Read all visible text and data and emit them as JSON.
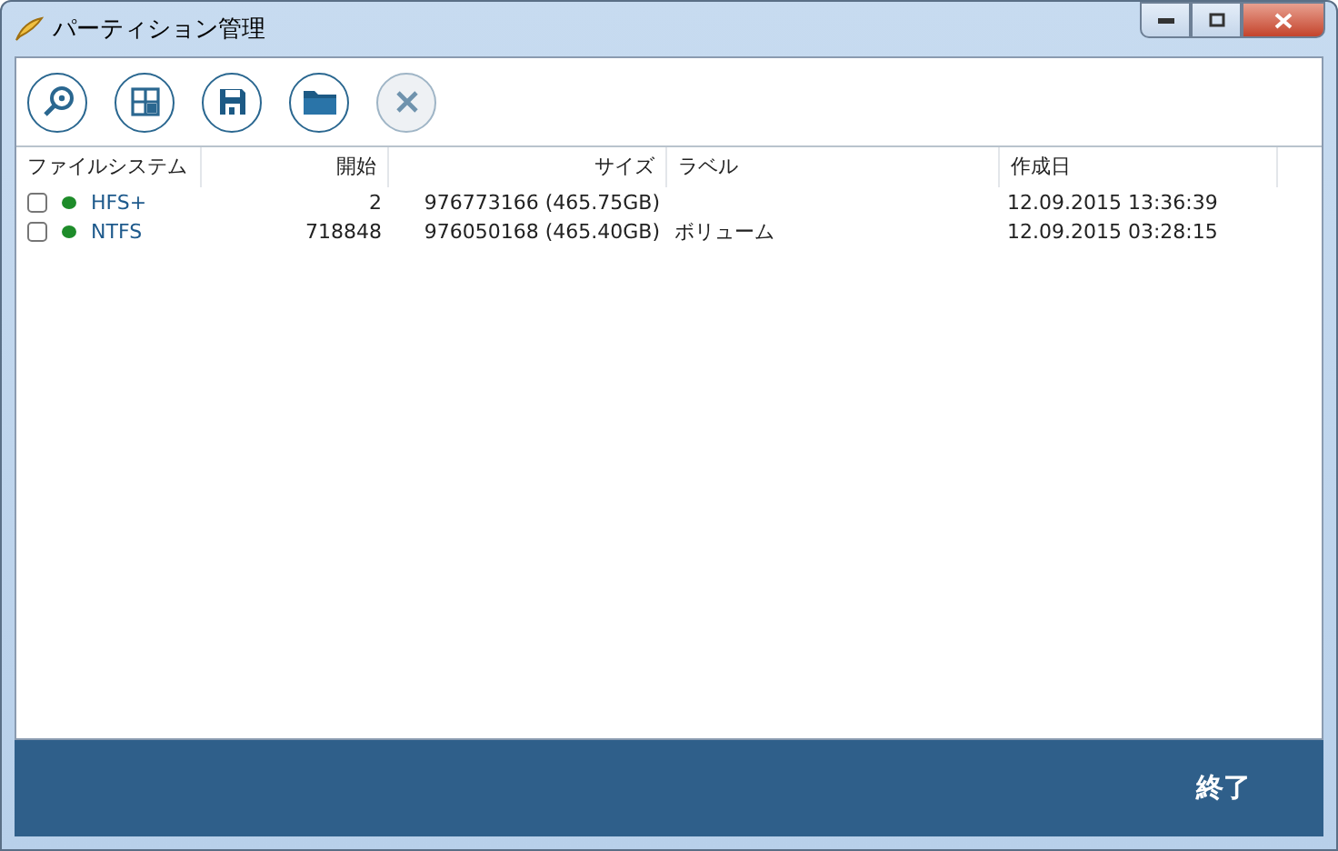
{
  "window": {
    "title": "パーティション管理"
  },
  "toolbar": [
    {
      "kind": "search",
      "disabled": false
    },
    {
      "kind": "grid",
      "disabled": false
    },
    {
      "kind": "save",
      "disabled": false
    },
    {
      "kind": "folder",
      "disabled": false
    },
    {
      "kind": "close",
      "disabled": true
    }
  ],
  "table": {
    "columns": [
      {
        "label": "ファイルシステム"
      },
      {
        "label": "開始"
      },
      {
        "label": "サイズ"
      },
      {
        "label": "ラベル"
      },
      {
        "label": "作成日"
      }
    ],
    "rows": [
      {
        "checked": false,
        "color": "#1e8c2a",
        "cells": [
          "HFS+",
          "2",
          "976773166 (465.75GB)",
          "",
          "12.09.2015 13:36:39"
        ]
      },
      {
        "checked": false,
        "color": "#1e8c2a",
        "cells": [
          "NTFS",
          "718848",
          "976050168 (465.40GB)",
          "ボリューム",
          "12.09.2015 03:28:15"
        ]
      }
    ]
  },
  "footer": {
    "button": "終了"
  }
}
